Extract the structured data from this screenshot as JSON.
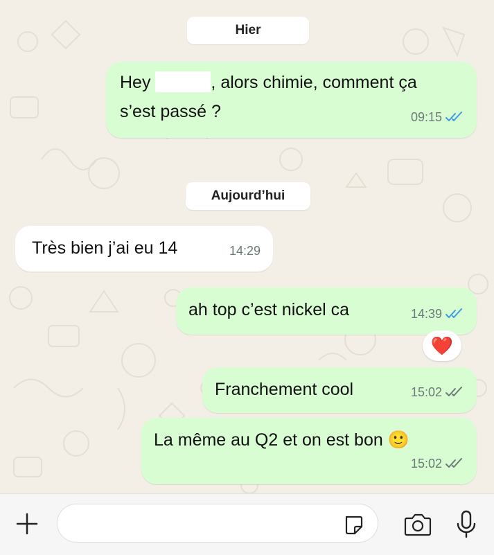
{
  "colors": {
    "wallpaper": "#f3efe6",
    "outgoing_bubble": "#d9fdd3",
    "incoming_bubble": "#ffffff",
    "read_ticks": "#3b9ae1",
    "delivered_ticks": "#6b7a76"
  },
  "dividers": {
    "yesterday": "Hier",
    "today": "Aujourd’hui"
  },
  "messages": [
    {
      "direction": "outgoing",
      "text_before": "Hey",
      "text_line1_after": ", alors chimie, comment ça",
      "text_line2": "s’est passé ?",
      "redacted": true,
      "time": "09:15",
      "status": "read"
    },
    {
      "direction": "incoming",
      "text": "Très bien j’ai eu 14",
      "time": "14:29"
    },
    {
      "direction": "outgoing",
      "text": "ah top c’est nickel ca",
      "time": "14:39",
      "status": "read",
      "reaction": "❤️"
    },
    {
      "direction": "outgoing",
      "text": "Franchement cool",
      "time": "15:02",
      "status": "delivered"
    },
    {
      "direction": "outgoing",
      "text": "La même au Q2 et on est bon 🙂",
      "time": "15:02",
      "status": "delivered"
    }
  ],
  "composer": {
    "placeholder": "",
    "icons": [
      "plus-icon",
      "sticker-icon",
      "camera-icon",
      "microphone-icon"
    ]
  }
}
